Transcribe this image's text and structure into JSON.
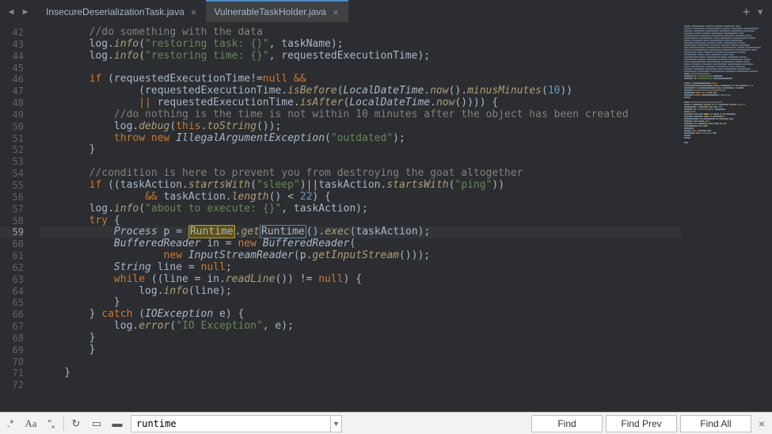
{
  "titlebar": {
    "tabs": [
      {
        "label": "InsecureDeserializationTask.java",
        "active": false
      },
      {
        "label": "VulnerableTaskHolder.java",
        "active": true
      }
    ]
  },
  "gutter": {
    "start": 42,
    "end": 72,
    "highlight": 59
  },
  "search": {
    "value": "runtime",
    "buttons": {
      "find": "Find",
      "find_prev": "Find Prev",
      "find_all": "Find All"
    }
  },
  "code": {
    "lines": [
      [
        [
          "        ",
          ""
        ],
        [
          "//do something with the data",
          "cmt"
        ]
      ],
      [
        [
          "        log.",
          ""
        ],
        [
          "info",
          "mth"
        ],
        [
          "(",
          ""
        ],
        [
          "\"restoring task: {}\"",
          "str"
        ],
        [
          ", taskName);",
          ""
        ]
      ],
      [
        [
          "        log.",
          ""
        ],
        [
          "info",
          "mth"
        ],
        [
          "(",
          ""
        ],
        [
          "\"restoring time: {}\"",
          "str"
        ],
        [
          ", requestedExecutionTime);",
          ""
        ]
      ],
      [
        [
          "",
          ""
        ]
      ],
      [
        [
          "        ",
          ""
        ],
        [
          "if",
          "kw"
        ],
        [
          " (requestedExecutionTime!=",
          ""
        ],
        [
          "null",
          "kw"
        ],
        [
          " ",
          ""
        ],
        [
          "&&",
          "kw"
        ]
      ],
      [
        [
          "                (requestedExecutionTime.",
          ""
        ],
        [
          "isBefore",
          "mth"
        ],
        [
          "(",
          ""
        ],
        [
          "LocalDateTime",
          "type"
        ],
        [
          ".",
          ""
        ],
        [
          "now",
          "mth"
        ],
        [
          "().",
          ""
        ],
        [
          "minusMinutes",
          "mth"
        ],
        [
          "(",
          ""
        ],
        [
          "10",
          "num"
        ],
        [
          "))",
          ""
        ]
      ],
      [
        [
          "                ",
          ""
        ],
        [
          "||",
          "kw"
        ],
        [
          " requestedExecutionTime.",
          ""
        ],
        [
          "isAfter",
          "mth"
        ],
        [
          "(",
          ""
        ],
        [
          "LocalDateTime",
          "type"
        ],
        [
          ".",
          ""
        ],
        [
          "now",
          "mth"
        ],
        [
          "()))) {",
          ""
        ]
      ],
      [
        [
          "            ",
          ""
        ],
        [
          "//do nothing is the time is not within 10 minutes after the object has been created",
          "cmt"
        ]
      ],
      [
        [
          "            log.",
          ""
        ],
        [
          "debug",
          "mth"
        ],
        [
          "(",
          ""
        ],
        [
          "this",
          "kw"
        ],
        [
          ".",
          ""
        ],
        [
          "toString",
          "mth"
        ],
        [
          "());",
          ""
        ]
      ],
      [
        [
          "            ",
          ""
        ],
        [
          "throw new ",
          "kw"
        ],
        [
          "IllegalArgumentException",
          "type"
        ],
        [
          "(",
          ""
        ],
        [
          "\"outdated\"",
          "str"
        ],
        [
          ");",
          ""
        ]
      ],
      [
        [
          "        }",
          ""
        ]
      ],
      [
        [
          "",
          ""
        ]
      ],
      [
        [
          "        ",
          ""
        ],
        [
          "//condition is here to prevent you from destroying the goat altogether",
          "cmt"
        ]
      ],
      [
        [
          "        ",
          ""
        ],
        [
          "if",
          "kw"
        ],
        [
          " ((taskAction.",
          ""
        ],
        [
          "startsWith",
          "mth"
        ],
        [
          "(",
          ""
        ],
        [
          "\"sleep\"",
          "str"
        ],
        [
          ")||taskAction.",
          ""
        ],
        [
          "startsWith",
          "mth"
        ],
        [
          "(",
          ""
        ],
        [
          "\"ping\"",
          "str"
        ],
        [
          "))",
          ""
        ]
      ],
      [
        [
          "                 ",
          ""
        ],
        [
          "&&",
          "kw"
        ],
        [
          " taskAction.",
          ""
        ],
        [
          "length",
          "mth"
        ],
        [
          "() < ",
          ""
        ],
        [
          "22",
          "num"
        ],
        [
          ") {",
          ""
        ]
      ],
      [
        [
          "        log.",
          ""
        ],
        [
          "info",
          "mth"
        ],
        [
          "(",
          ""
        ],
        [
          "\"about to execute: {}\"",
          "str"
        ],
        [
          ", taskAction);",
          ""
        ]
      ],
      [
        [
          "        ",
          ""
        ],
        [
          "try",
          "kw"
        ],
        [
          " {",
          ""
        ]
      ],
      [
        [
          "            ",
          ""
        ],
        [
          "Process",
          "type"
        ],
        [
          " p = ",
          ""
        ],
        [
          "Runtime",
          "hl-y"
        ],
        [
          ".",
          ""
        ],
        [
          "get",
          "mth"
        ],
        [
          "Runtime",
          "hl-bx"
        ],
        [
          "().",
          ""
        ],
        [
          "exec",
          "mth"
        ],
        [
          "(taskAction);",
          ""
        ]
      ],
      [
        [
          "            ",
          ""
        ],
        [
          "BufferedReader",
          "type"
        ],
        [
          " in = ",
          ""
        ],
        [
          "new ",
          "kw"
        ],
        [
          "BufferedReader",
          "type"
        ],
        [
          "(",
          ""
        ]
      ],
      [
        [
          "                    ",
          ""
        ],
        [
          "new ",
          "kw"
        ],
        [
          "InputStreamReader",
          "type"
        ],
        [
          "(p.",
          ""
        ],
        [
          "getInputStream",
          "mth"
        ],
        [
          "()));",
          ""
        ]
      ],
      [
        [
          "            ",
          ""
        ],
        [
          "String",
          "type"
        ],
        [
          " line = ",
          ""
        ],
        [
          "null",
          "kw"
        ],
        [
          ";",
          ""
        ]
      ],
      [
        [
          "            ",
          ""
        ],
        [
          "while",
          "kw"
        ],
        [
          " ((line = in.",
          ""
        ],
        [
          "readLine",
          "mth"
        ],
        [
          "()) != ",
          ""
        ],
        [
          "null",
          "kw"
        ],
        [
          ") {",
          ""
        ]
      ],
      [
        [
          "                log.",
          ""
        ],
        [
          "info",
          "mth"
        ],
        [
          "(line);",
          ""
        ]
      ],
      [
        [
          "            }",
          ""
        ]
      ],
      [
        [
          "        } ",
          ""
        ],
        [
          "catch",
          "kw"
        ],
        [
          " (",
          ""
        ],
        [
          "IOException",
          "type"
        ],
        [
          " e) {",
          ""
        ]
      ],
      [
        [
          "            log.",
          ""
        ],
        [
          "error",
          "mth"
        ],
        [
          "(",
          ""
        ],
        [
          "\"IO Exception\"",
          "str"
        ],
        [
          ", e);",
          ""
        ]
      ],
      [
        [
          "        }",
          ""
        ]
      ],
      [
        [
          "        }",
          ""
        ]
      ],
      [
        [
          "",
          ""
        ]
      ],
      [
        [
          "    }",
          ""
        ]
      ],
      [
        [
          "",
          ""
        ]
      ]
    ]
  },
  "colors": {
    "bg": "#2b2d30",
    "fg": "#a9b7c6",
    "keyword": "#cc7832",
    "string": "#6a8759",
    "number": "#6897bb",
    "comment": "#808080",
    "method": "#b09d79"
  }
}
